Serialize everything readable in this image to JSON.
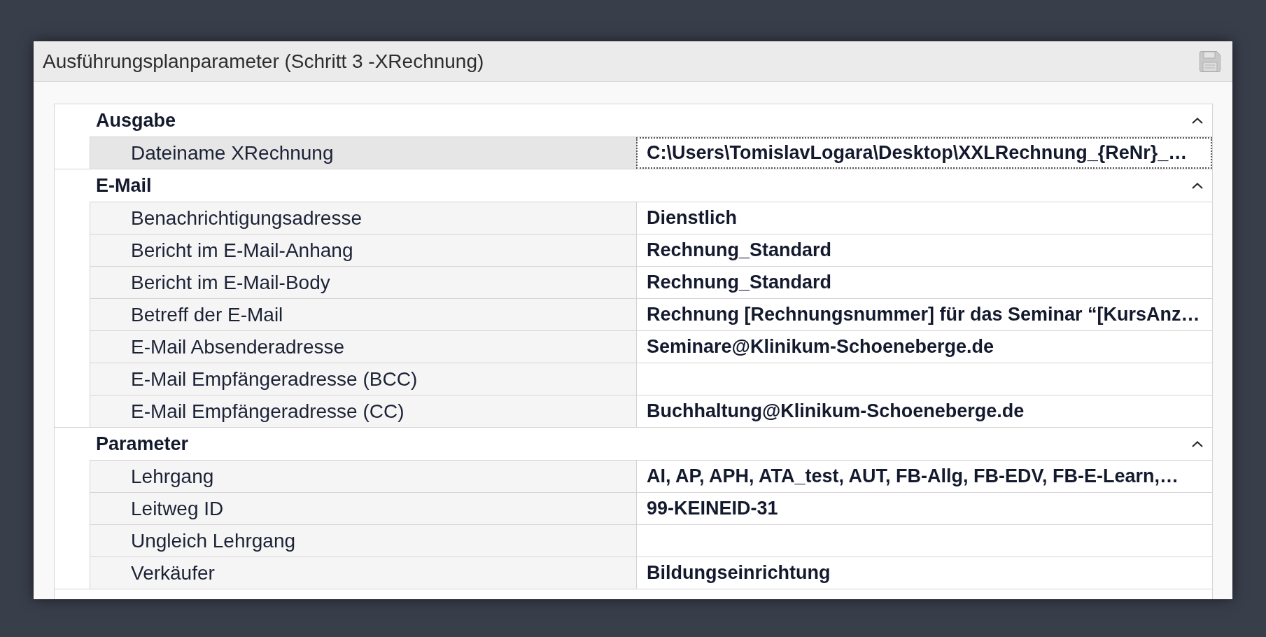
{
  "window": {
    "title": "Ausführungsplanparameter (Schritt 3 -XRechnung)"
  },
  "groups": [
    {
      "title": "Ausgabe",
      "expanded": true,
      "properties": [
        {
          "label": "Dateiname XRechnung",
          "value": "C:\\Users\\TomislavLogara\\Desktop\\XXLRechnung_{ReNr}_…",
          "selected": true
        }
      ]
    },
    {
      "title": "E-Mail",
      "expanded": true,
      "properties": [
        {
          "label": "Benachrichtigungsadresse",
          "value": "Dienstlich",
          "selected": false
        },
        {
          "label": "Bericht im E-Mail-Anhang",
          "value": "Rechnung_Standard",
          "selected": false
        },
        {
          "label": "Bericht im E-Mail-Body",
          "value": "Rechnung_Standard",
          "selected": false
        },
        {
          "label": "Betreff der E-Mail",
          "value": "Rechnung [Rechnungsnummer] für das Seminar “[KursAnz…",
          "selected": false
        },
        {
          "label": "E-Mail Absenderadresse",
          "value": "Seminare@Klinikum-Schoeneberge.de",
          "selected": false
        },
        {
          "label": "E-Mail Empfängeradresse (BCC)",
          "selected": false
        },
        {
          "label": "E-Mail Empfängeradresse (CC)",
          "value": "Buchhaltung@Klinikum-Schoeneberge.de",
          "selected": false
        }
      ]
    },
    {
      "title": "Parameter",
      "expanded": true,
      "properties": [
        {
          "label": "Lehrgang",
          "value": "AI, AP, APH, ATA_test, AUT, FB-Allg, FB-EDV, FB-E-Learn,…",
          "selected": false
        },
        {
          "label": "Leitweg ID",
          "value": "99-KEINEID-31",
          "selected": false
        },
        {
          "label": "Ungleich Lehrgang",
          "selected": false
        },
        {
          "label": "Verkäufer",
          "value": "Bildungseinrichtung",
          "selected": false
        }
      ]
    }
  ]
}
